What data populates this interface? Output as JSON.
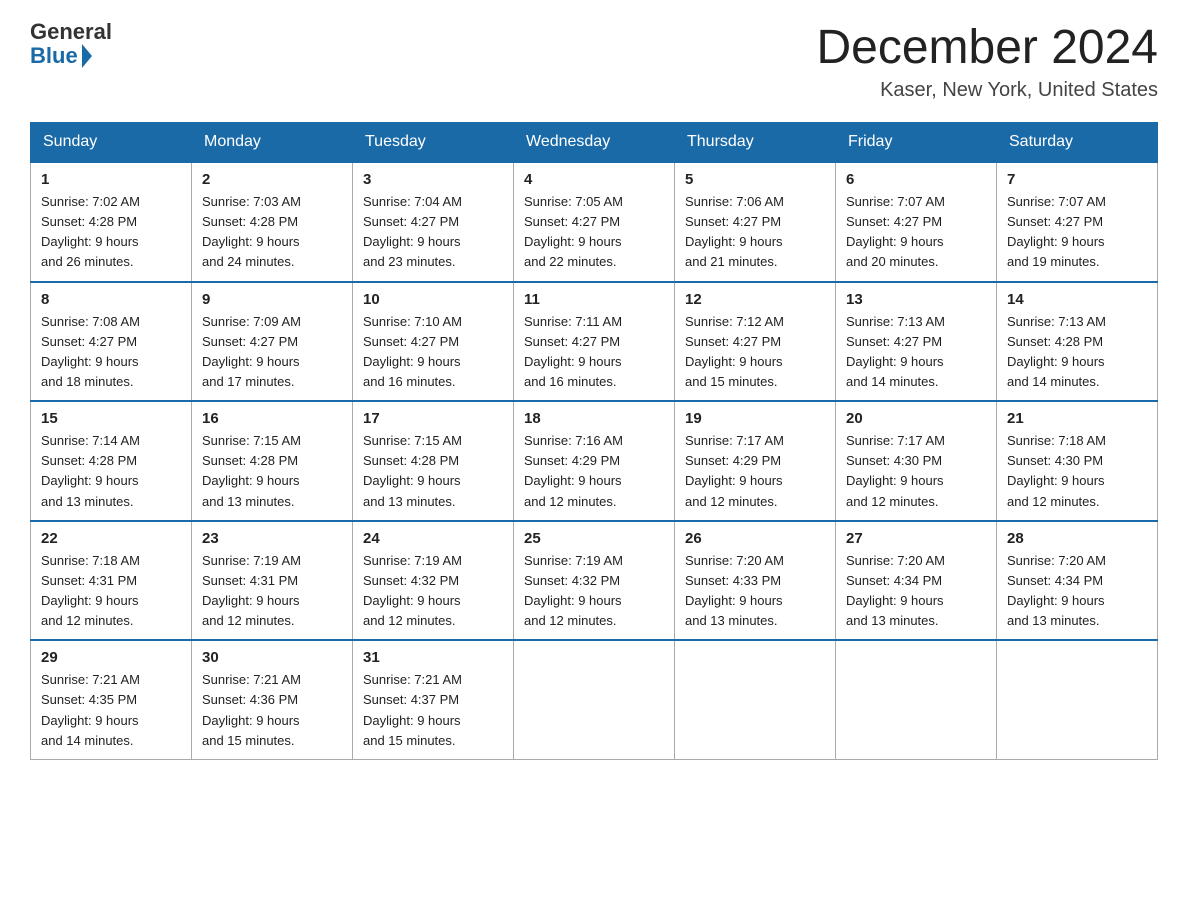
{
  "logo": {
    "general": "General",
    "blue": "Blue"
  },
  "title": "December 2024",
  "location": "Kaser, New York, United States",
  "days_of_week": [
    "Sunday",
    "Monday",
    "Tuesday",
    "Wednesday",
    "Thursday",
    "Friday",
    "Saturday"
  ],
  "weeks": [
    [
      {
        "day": "1",
        "sunrise": "7:02 AM",
        "sunset": "4:28 PM",
        "daylight": "9 hours and 26 minutes."
      },
      {
        "day": "2",
        "sunrise": "7:03 AM",
        "sunset": "4:28 PM",
        "daylight": "9 hours and 24 minutes."
      },
      {
        "day": "3",
        "sunrise": "7:04 AM",
        "sunset": "4:27 PM",
        "daylight": "9 hours and 23 minutes."
      },
      {
        "day": "4",
        "sunrise": "7:05 AM",
        "sunset": "4:27 PM",
        "daylight": "9 hours and 22 minutes."
      },
      {
        "day": "5",
        "sunrise": "7:06 AM",
        "sunset": "4:27 PM",
        "daylight": "9 hours and 21 minutes."
      },
      {
        "day": "6",
        "sunrise": "7:07 AM",
        "sunset": "4:27 PM",
        "daylight": "9 hours and 20 minutes."
      },
      {
        "day": "7",
        "sunrise": "7:07 AM",
        "sunset": "4:27 PM",
        "daylight": "9 hours and 19 minutes."
      }
    ],
    [
      {
        "day": "8",
        "sunrise": "7:08 AM",
        "sunset": "4:27 PM",
        "daylight": "9 hours and 18 minutes."
      },
      {
        "day": "9",
        "sunrise": "7:09 AM",
        "sunset": "4:27 PM",
        "daylight": "9 hours and 17 minutes."
      },
      {
        "day": "10",
        "sunrise": "7:10 AM",
        "sunset": "4:27 PM",
        "daylight": "9 hours and 16 minutes."
      },
      {
        "day": "11",
        "sunrise": "7:11 AM",
        "sunset": "4:27 PM",
        "daylight": "9 hours and 16 minutes."
      },
      {
        "day": "12",
        "sunrise": "7:12 AM",
        "sunset": "4:27 PM",
        "daylight": "9 hours and 15 minutes."
      },
      {
        "day": "13",
        "sunrise": "7:13 AM",
        "sunset": "4:27 PM",
        "daylight": "9 hours and 14 minutes."
      },
      {
        "day": "14",
        "sunrise": "7:13 AM",
        "sunset": "4:28 PM",
        "daylight": "9 hours and 14 minutes."
      }
    ],
    [
      {
        "day": "15",
        "sunrise": "7:14 AM",
        "sunset": "4:28 PM",
        "daylight": "9 hours and 13 minutes."
      },
      {
        "day": "16",
        "sunrise": "7:15 AM",
        "sunset": "4:28 PM",
        "daylight": "9 hours and 13 minutes."
      },
      {
        "day": "17",
        "sunrise": "7:15 AM",
        "sunset": "4:28 PM",
        "daylight": "9 hours and 13 minutes."
      },
      {
        "day": "18",
        "sunrise": "7:16 AM",
        "sunset": "4:29 PM",
        "daylight": "9 hours and 12 minutes."
      },
      {
        "day": "19",
        "sunrise": "7:17 AM",
        "sunset": "4:29 PM",
        "daylight": "9 hours and 12 minutes."
      },
      {
        "day": "20",
        "sunrise": "7:17 AM",
        "sunset": "4:30 PM",
        "daylight": "9 hours and 12 minutes."
      },
      {
        "day": "21",
        "sunrise": "7:18 AM",
        "sunset": "4:30 PM",
        "daylight": "9 hours and 12 minutes."
      }
    ],
    [
      {
        "day": "22",
        "sunrise": "7:18 AM",
        "sunset": "4:31 PM",
        "daylight": "9 hours and 12 minutes."
      },
      {
        "day": "23",
        "sunrise": "7:19 AM",
        "sunset": "4:31 PM",
        "daylight": "9 hours and 12 minutes."
      },
      {
        "day": "24",
        "sunrise": "7:19 AM",
        "sunset": "4:32 PM",
        "daylight": "9 hours and 12 minutes."
      },
      {
        "day": "25",
        "sunrise": "7:19 AM",
        "sunset": "4:32 PM",
        "daylight": "9 hours and 12 minutes."
      },
      {
        "day": "26",
        "sunrise": "7:20 AM",
        "sunset": "4:33 PM",
        "daylight": "9 hours and 13 minutes."
      },
      {
        "day": "27",
        "sunrise": "7:20 AM",
        "sunset": "4:34 PM",
        "daylight": "9 hours and 13 minutes."
      },
      {
        "day": "28",
        "sunrise": "7:20 AM",
        "sunset": "4:34 PM",
        "daylight": "9 hours and 13 minutes."
      }
    ],
    [
      {
        "day": "29",
        "sunrise": "7:21 AM",
        "sunset": "4:35 PM",
        "daylight": "9 hours and 14 minutes."
      },
      {
        "day": "30",
        "sunrise": "7:21 AM",
        "sunset": "4:36 PM",
        "daylight": "9 hours and 15 minutes."
      },
      {
        "day": "31",
        "sunrise": "7:21 AM",
        "sunset": "4:37 PM",
        "daylight": "9 hours and 15 minutes."
      },
      null,
      null,
      null,
      null
    ]
  ],
  "labels": {
    "sunrise": "Sunrise:",
    "sunset": "Sunset:",
    "daylight": "Daylight:"
  }
}
